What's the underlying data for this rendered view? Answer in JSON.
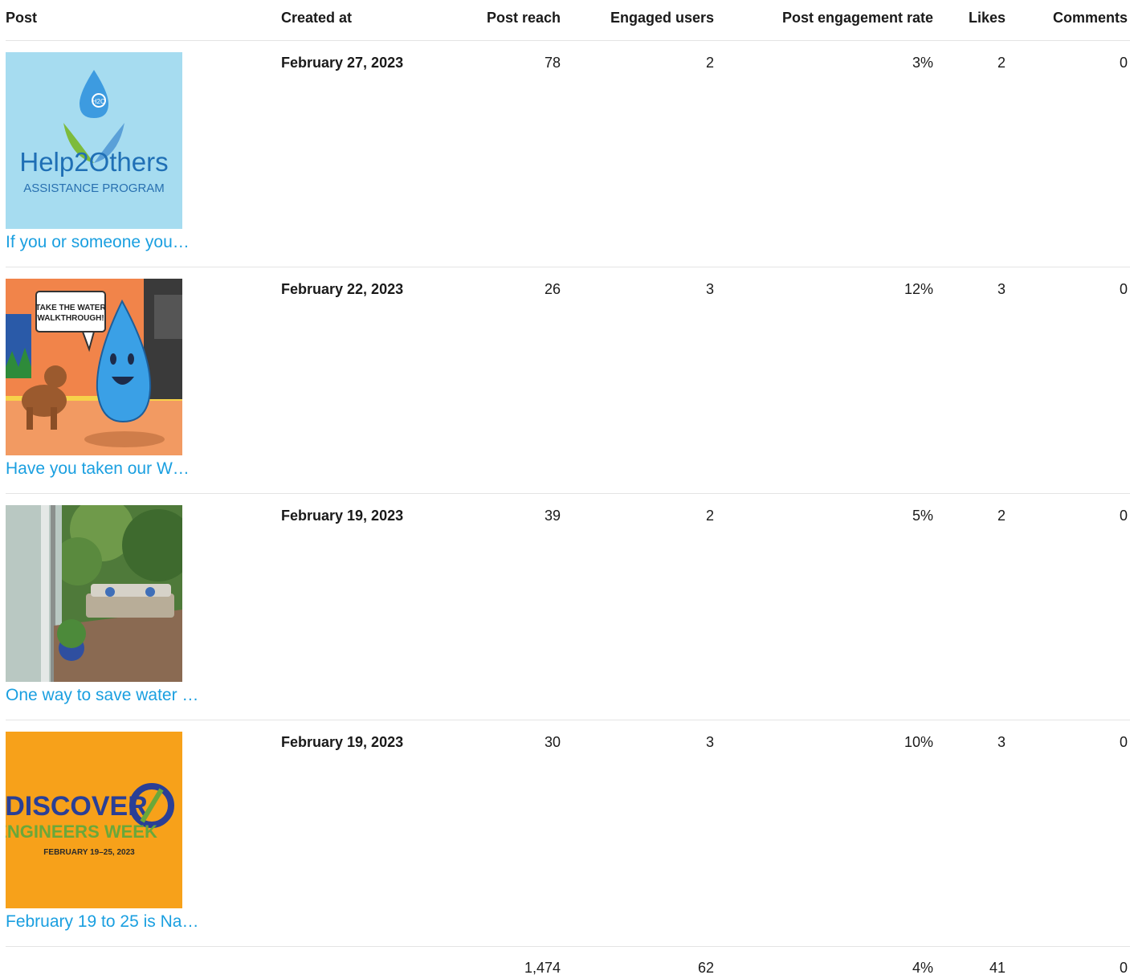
{
  "columns": {
    "post": "Post",
    "created_at": "Created at",
    "post_reach": "Post reach",
    "engaged_users": "Engaged users",
    "engagement_rate": "Post engagement rate",
    "likes": "Likes",
    "comments": "Comments"
  },
  "rows": [
    {
      "thumb_title": "Help2Others",
      "thumb_subtitle": "ASSISTANCE PROGRAM",
      "thumb_badge": "H2O",
      "post_text": "If you or someone you…",
      "created_at": "February 27, 2023",
      "post_reach": "78",
      "engaged_users": "2",
      "engagement_rate": "3%",
      "likes": "2",
      "comments": "0"
    },
    {
      "thumb_bubble_line1": "TAKE THE WATER",
      "thumb_bubble_line2": "WALKTHROUGH!",
      "post_text": "Have you taken our W…",
      "created_at": "February 22, 2023",
      "post_reach": "26",
      "engaged_users": "3",
      "engagement_rate": "12%",
      "likes": "3",
      "comments": "0"
    },
    {
      "post_text": "One way to save water …",
      "created_at": "February 19, 2023",
      "post_reach": "39",
      "engaged_users": "2",
      "engagement_rate": "5%",
      "likes": "2",
      "comments": "0"
    },
    {
      "thumb_title": "DISCOVER",
      "thumb_subtitle": "ENGINEERS WEEK",
      "thumb_dates": "FEBRUARY 19–25, 2023",
      "post_text": "February 19 to 25 is Na…",
      "created_at": "February 19, 2023",
      "post_reach": "30",
      "engaged_users": "3",
      "engagement_rate": "10%",
      "likes": "3",
      "comments": "0"
    }
  ],
  "totals": {
    "post_reach": "1,474",
    "engaged_users": "62",
    "engagement_rate": "4%",
    "likes": "41",
    "comments": "0"
  },
  "colors": {
    "link": "#1a9fe0",
    "divider": "#e4e4e4",
    "help2others_bg": "#a6dcf0",
    "discover_bg": "#f7a11a"
  }
}
